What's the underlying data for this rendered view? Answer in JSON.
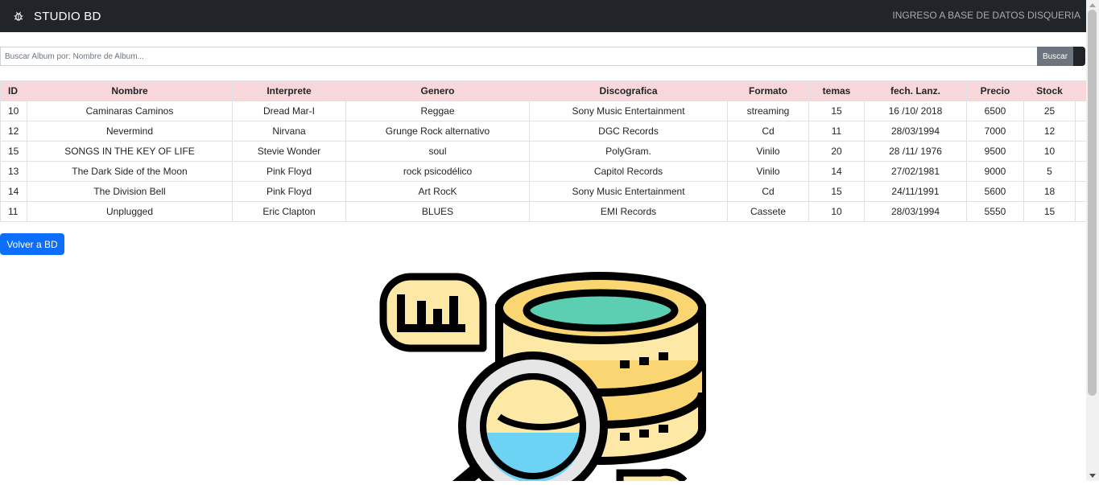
{
  "navbar": {
    "brand": "STUDIO BD",
    "brand_icon": "bug-icon",
    "right_link": "INGRESO A BASE DE DATOS DISQUERIA"
  },
  "search": {
    "placeholder": "Buscar Album por: Nombre de Album...",
    "button": "Buscar"
  },
  "table": {
    "headers": [
      "ID",
      "Nombre",
      "Interprete",
      "Genero",
      "Discografica",
      "Formato",
      "temas",
      "fech. Lanz.",
      "Precio",
      "Stock"
    ],
    "rows": [
      [
        "10",
        "Caminaras Caminos",
        "Dread Mar-I",
        "Reggae",
        "Sony Music Entertainment",
        "streaming",
        "15",
        "16 /10/ 2018",
        "6500",
        "25"
      ],
      [
        "12",
        "Nevermind",
        "Nirvana",
        "Grunge Rock alternativo",
        "DGC Records",
        "Cd",
        "11",
        "28/03/1994",
        "7000",
        "12"
      ],
      [
        "15",
        "SONGS IN THE KEY OF LIFE",
        "Stevie Wonder",
        "soul",
        "PolyGram.",
        "Vinilo",
        "20",
        "28 /11/ 1976",
        "9500",
        "10"
      ],
      [
        "13",
        "The Dark Side of the Moon",
        "Pink Floyd",
        "rock psicodélico",
        "Capitol Records",
        "Vinilo",
        "14",
        "27/02/1981",
        "9000",
        "5"
      ],
      [
        "14",
        "The Division Bell",
        "Pink Floyd",
        "Art RocK",
        "Sony Music Entertainment",
        "Cd",
        "15",
        "24/11/1991",
        "5600",
        "18"
      ],
      [
        "11",
        "Unplugged",
        "Eric Clapton",
        "BLUES",
        "EMI Records",
        "Cassete",
        "10",
        "28/03/1994",
        "5550",
        "15"
      ]
    ]
  },
  "back_button": "Volver a BD",
  "illustration": "database-search-icon",
  "colors": {
    "navbar": "#212529",
    "header_row": "#f8d7da",
    "primary": "#0d6efd",
    "search_button": "#6c757d"
  }
}
